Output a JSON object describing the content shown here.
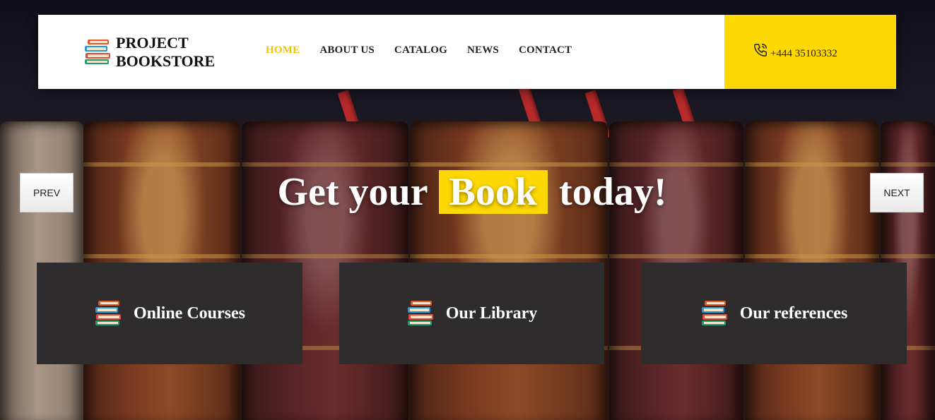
{
  "brand": {
    "line1": "PROJECT",
    "line2": "BOOKSTORE"
  },
  "nav": {
    "items": [
      {
        "label": "HOME",
        "active": true
      },
      {
        "label": "ABOUT US",
        "active": false
      },
      {
        "label": "CATALOG",
        "active": false
      },
      {
        "label": "NEWS",
        "active": false
      },
      {
        "label": "CONTACT",
        "active": false
      }
    ]
  },
  "phone": {
    "number": "+444 35103332",
    "icon": "phone-icon"
  },
  "hero": {
    "headline_before": "Get your",
    "headline_highlight": "Book",
    "headline_after": "today!",
    "prev_label": "PREV",
    "next_label": "NEXT"
  },
  "cards": [
    {
      "label": "Online Courses",
      "icon": "books-stack-icon"
    },
    {
      "label": "Our Library",
      "icon": "books-stack-icon"
    },
    {
      "label": "Our references",
      "icon": "books-stack-icon"
    }
  ],
  "colors": {
    "accent_yellow": "#fdd803",
    "nav_active": "#f3c300",
    "card_bg": "#2e2c2d",
    "header_bg": "#ffffff"
  }
}
